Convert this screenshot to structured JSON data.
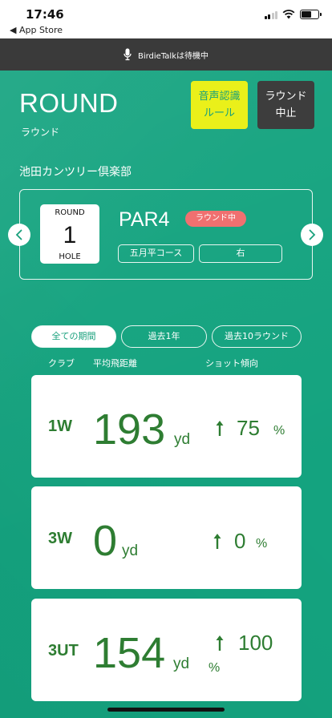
{
  "status_bar": {
    "time": "17:46",
    "back_label": "◀ App Store"
  },
  "voice_bar": {
    "label": "BirdieTalkは待機中"
  },
  "header": {
    "title": "ROUND",
    "subtitle": "ラウンド",
    "voice_rule_button": {
      "line1": "音声認識",
      "line2": "ルール"
    },
    "stop_button": {
      "line1": "ラウンド",
      "line2": "中止"
    }
  },
  "course": {
    "name": "池田カンツリー倶楽部"
  },
  "hole": {
    "top_label": "ROUND",
    "number": "1",
    "bottom_label": "HOLE",
    "par": "PAR4",
    "status_badge": "ラウンド中",
    "course_tag": "五月平コース",
    "side_tag": "右"
  },
  "tabs": [
    {
      "label": "全ての期間",
      "active": true
    },
    {
      "label": "過去1年",
      "active": false
    },
    {
      "label": "過去10ラウンド",
      "active": false
    }
  ],
  "columns": {
    "club": "クラブ",
    "distance": "平均飛距離",
    "trend": "ショット傾向"
  },
  "clubs": [
    {
      "club": "1W",
      "distance": "193",
      "unit": "yd",
      "trend": "75",
      "trend_unit": "%"
    },
    {
      "club": "3W",
      "distance": "0",
      "unit": "yd",
      "trend": "0",
      "trend_unit": "%"
    },
    {
      "club": "3UT",
      "distance": "154",
      "unit": "yd",
      "trend": "100",
      "trend_unit": "%"
    }
  ],
  "colors": {
    "background": "#14a37f",
    "accent_yellow": "#eaf01a",
    "badge_red": "#f07070",
    "club_text": "#2e7d32"
  },
  "icons": [
    "microphone-icon",
    "chevron-left-icon",
    "chevron-right-icon",
    "arrow-up-icon",
    "signal-icon",
    "wifi-icon",
    "battery-icon"
  ]
}
